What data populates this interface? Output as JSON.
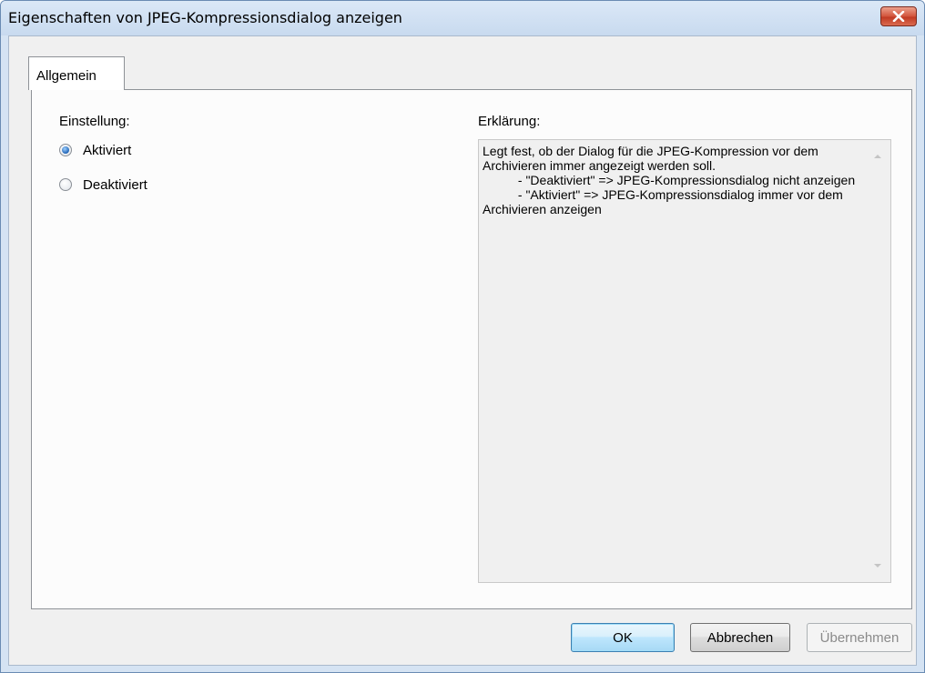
{
  "window": {
    "title": "Eigenschaften von JPEG-Kompressionsdialog anzeigen"
  },
  "tabs": [
    {
      "label": "Allgemein",
      "selected": true
    }
  ],
  "setting": {
    "label": "Einstellung:",
    "options": [
      {
        "label": "Aktiviert",
        "checked": true
      },
      {
        "label": "Deaktiviert",
        "checked": false
      }
    ]
  },
  "explanation": {
    "label": "Erklärung:",
    "text": "Legt fest, ob der Dialog für die JPEG-Kompression vor dem Archivieren immer angezeigt werden soll.\n          - \"Deaktiviert\" => JPEG-Kompressionsdialog nicht anzeigen\n          - \"Aktiviert\" => JPEG-Kompressionsdialog immer vor dem Archivieren anzeigen"
  },
  "buttons": {
    "ok": "OK",
    "cancel": "Abbrechen",
    "apply": "Übernehmen"
  },
  "colors": {
    "close_button": "#c13a23",
    "ok_button_border": "#3c7fb1",
    "disabled_text": "#8a8a8a"
  },
  "icons": {
    "close": "close-icon",
    "scroll_up": "scroll-up-arrow-icon",
    "scroll_down": "scroll-down-arrow-icon"
  }
}
